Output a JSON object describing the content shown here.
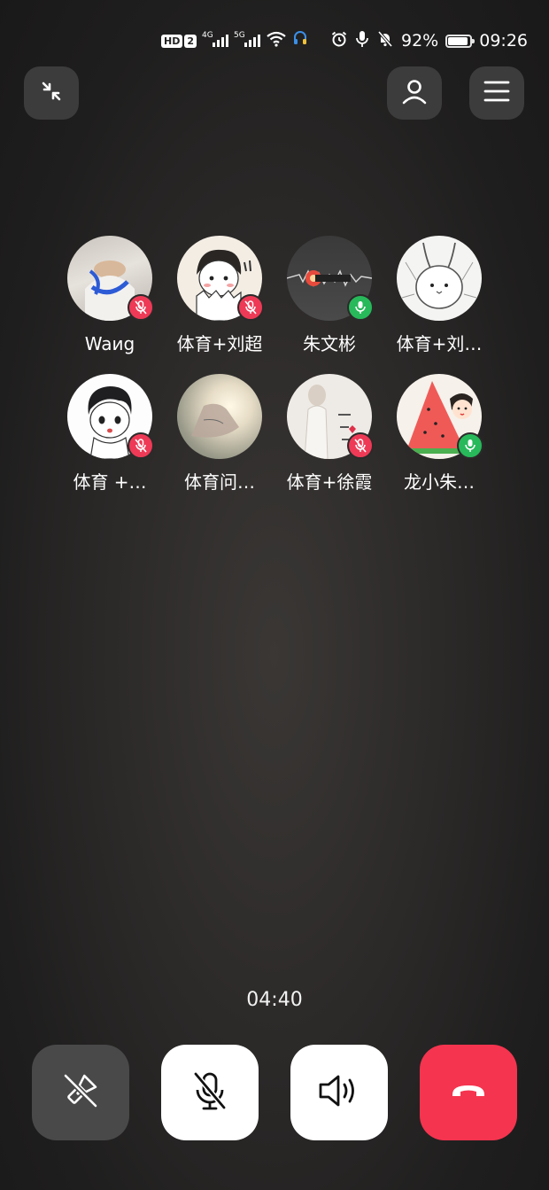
{
  "status_bar": {
    "hd_label": "HD",
    "sim_label": "2",
    "net1": "4G",
    "net2": "5G",
    "battery_percent": "92%",
    "battery_level": 0.92,
    "time": "09:26"
  },
  "top_bar": {
    "minimize_icon": "shrink-icon",
    "add_member_icon": "person-icon",
    "menu_icon": "menu-icon"
  },
  "participants": [
    {
      "name": "Waиg",
      "mic": "muted"
    },
    {
      "name": "体育+刘超",
      "mic": "muted"
    },
    {
      "name": "朱文彬",
      "mic": "on"
    },
    {
      "name": "体育+刘…",
      "mic": "none"
    },
    {
      "name": "体育 +…",
      "mic": "muted"
    },
    {
      "name": "体育问…",
      "mic": "none"
    },
    {
      "name": "体育+徐霞",
      "mic": "muted"
    },
    {
      "name": "龙小朱…",
      "mic": "on"
    }
  ],
  "call": {
    "duration": "04:40"
  },
  "controls": {
    "flip_icon": "flashlight-off-icon",
    "mute_icon": "mic-off-icon",
    "speaker_icon": "speaker-icon",
    "hangup_icon": "hangup-icon",
    "hangup_color": "#f5344f"
  },
  "colors": {
    "muted_badge": "#ee3a56",
    "active_badge": "#27b95a"
  }
}
